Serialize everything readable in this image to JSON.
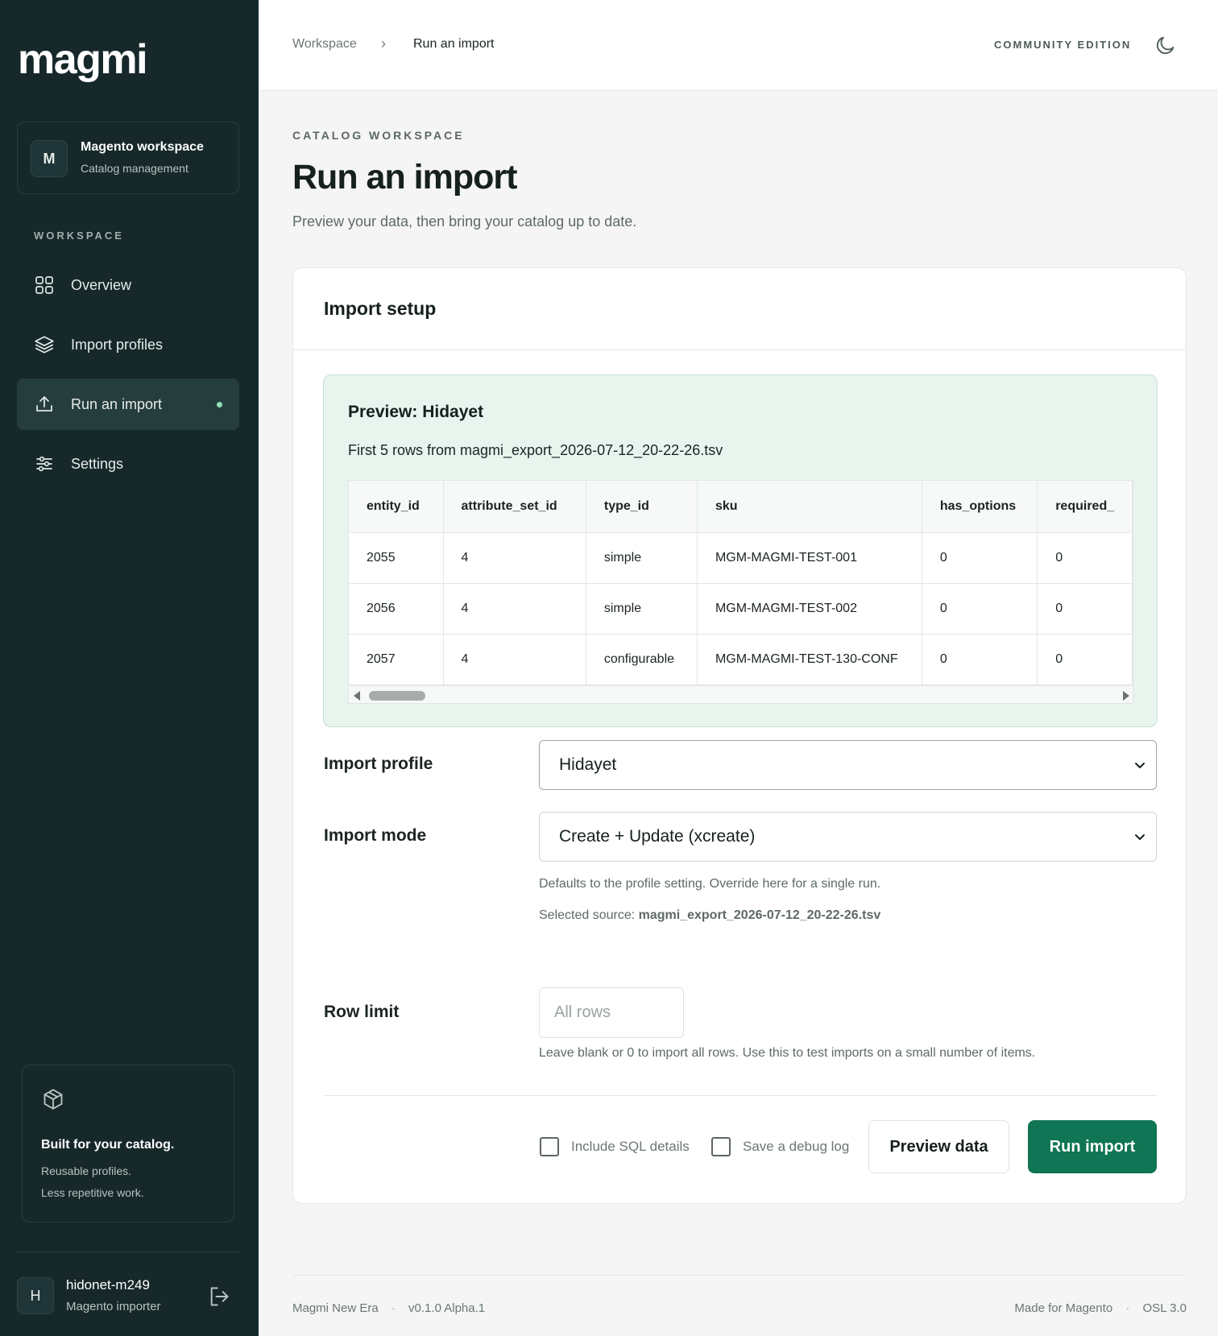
{
  "sidebar": {
    "logo": "magmi",
    "workspace": {
      "avatar": "M",
      "name": "Magento workspace",
      "subtitle": "Catalog management"
    },
    "section_label": "WORKSPACE",
    "items": [
      {
        "label": "Overview",
        "icon": "grid-icon"
      },
      {
        "label": "Import profiles",
        "icon": "layers-icon"
      },
      {
        "label": "Run an import",
        "icon": "upload-icon",
        "active": true
      },
      {
        "label": "Settings",
        "icon": "sliders-icon"
      }
    ],
    "promo": {
      "title": "Built for your catalog.",
      "line1": "Reusable profiles.",
      "line2": "Less repetitive work."
    },
    "user": {
      "avatar": "H",
      "name": "hidonet-m249",
      "role": "Magento importer"
    }
  },
  "topbar": {
    "breadcrumb": [
      "Workspace",
      "Run an import"
    ],
    "breadcrumb_sep": "›",
    "edition": "COMMUNITY EDITION"
  },
  "page": {
    "eyebrow": "CATALOG WORKSPACE",
    "title": "Run an import",
    "subtitle": "Preview your data, then bring your catalog up to date."
  },
  "card": {
    "title": "Import setup",
    "preview": {
      "title": "Preview: Hidayet",
      "subtitle": "First 5 rows from magmi_export_2026-07-12_20-22-26.tsv",
      "columns": [
        "entity_id",
        "attribute_set_id",
        "type_id",
        "sku",
        "has_options",
        "required_"
      ],
      "rows": [
        [
          "2055",
          "4",
          "simple",
          "MGM-MAGMI-TEST-001",
          "0",
          "0"
        ],
        [
          "2056",
          "4",
          "simple",
          "MGM-MAGMI-TEST-002",
          "0",
          "0"
        ],
        [
          "2057",
          "4",
          "configurable",
          "MGM-MAGMI-TEST-130-CONF",
          "0",
          "0"
        ]
      ]
    },
    "form": {
      "profile_label": "Import profile",
      "profile_value": "Hidayet",
      "mode_label": "Import mode",
      "mode_value": "Create + Update (xcreate)",
      "mode_hint": "Defaults to the profile setting. Override here for a single run.",
      "source_prefix": "Selected source:",
      "source_file": "magmi_export_2026-07-12_20-22-26.tsv",
      "row_limit_label": "Row limit",
      "row_limit_placeholder": "All rows",
      "row_limit_hint": "Leave blank or 0 to import all rows. Use this to test imports on a small number of items."
    },
    "actions": {
      "sql_label": "Include SQL details",
      "debug_label": "Save a debug log",
      "preview_label": "Preview data",
      "run_label": "Run import"
    }
  },
  "footer": {
    "app": "Magmi New Era",
    "version": "v0.1.0 Alpha.1",
    "made_for": "Made for Magento",
    "license": "OSL 3.0",
    "sep": "·"
  },
  "colors": {
    "sidebar_bg": "#16282a",
    "accent": "#0f7554",
    "preview_bg": "#e8f4ee",
    "active_dot": "#8fe0b6"
  }
}
